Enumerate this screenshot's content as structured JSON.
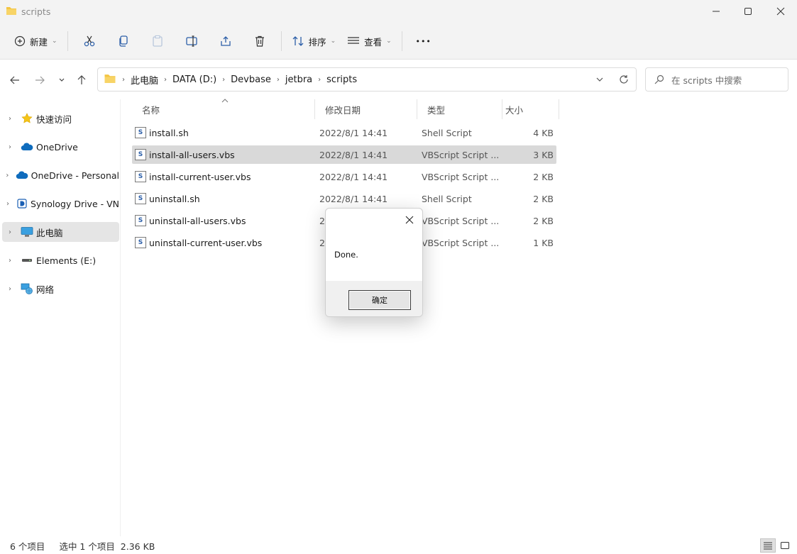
{
  "window": {
    "title": "scripts",
    "colors": {
      "folder": "#f4c542",
      "selection": "#d9d9d9",
      "accent": "#2c5fa8"
    }
  },
  "toolbar": {
    "new_label": "新建",
    "sort_label": "排序",
    "view_label": "查看",
    "more_label": "•••"
  },
  "address": {
    "segments": [
      "此电脑",
      "DATA (D:)",
      "Devbase",
      "jetbra",
      "scripts"
    ]
  },
  "search": {
    "placeholder": "在 scripts 中搜索"
  },
  "nav": {
    "items": [
      {
        "label": "快速访问",
        "icon": "star-icon"
      },
      {
        "label": "OneDrive",
        "icon": "cloud-icon"
      },
      {
        "label": "OneDrive - Personal",
        "icon": "cloud-icon"
      },
      {
        "label": "Synology Drive - VN",
        "icon": "synology-drive-icon"
      },
      {
        "label": "此电脑",
        "icon": "computer-icon"
      },
      {
        "label": "Elements (E:)",
        "icon": "drive-icon"
      },
      {
        "label": "网络",
        "icon": "network-icon"
      }
    ]
  },
  "columns": {
    "name": "名称",
    "date": "修改日期",
    "type": "类型",
    "size": "大小"
  },
  "files": [
    {
      "name": "install.sh",
      "date": "2022/8/1 14:41",
      "type": "Shell Script",
      "size": "4 KB"
    },
    {
      "name": "install-all-users.vbs",
      "date": "2022/8/1 14:41",
      "type": "VBScript Script ...",
      "size": "3 KB"
    },
    {
      "name": "install-current-user.vbs",
      "date": "2022/8/1 14:41",
      "type": "VBScript Script ...",
      "size": "2 KB"
    },
    {
      "name": "uninstall.sh",
      "date": "2022/8/1 14:41",
      "type": "Shell Script",
      "size": "2 KB"
    },
    {
      "name": "uninstall-all-users.vbs",
      "date": "2",
      "type": "VBScript Script ...",
      "size": "2 KB"
    },
    {
      "name": "uninstall-current-user.vbs",
      "date": "2",
      "type": "VBScript Script ...",
      "size": "1 KB"
    }
  ],
  "status": {
    "item_count": "6 个项目",
    "selection": "选中 1 个项目  2.36 KB"
  },
  "dialog": {
    "message": "Done.",
    "ok_label": "确定"
  }
}
